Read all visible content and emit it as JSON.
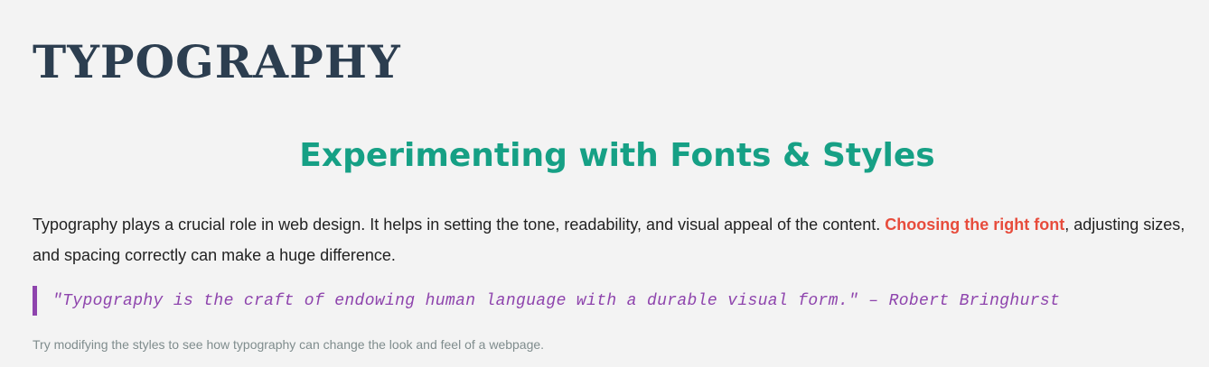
{
  "page": {
    "title": "TYPOGRAPHY",
    "subtitle": "Experimenting with Fonts & Styles",
    "paragraph": {
      "before": "Typography plays a crucial role in web design. It helps in setting the tone, readability, and visual appeal of the content. ",
      "highlight": "Choosing the right font",
      "after": ", adjusting sizes, and spacing correctly can make a huge difference."
    },
    "quote": "\"Typography is the craft of endowing human language with a durable visual form.\" – Robert Bringhurst",
    "note": "Try modifying the styles to see how typography can change the look and feel of a webpage."
  },
  "colors": {
    "background": "#f3f3f3",
    "title": "#2c3e50",
    "subtitle": "#16a085",
    "highlight": "#e74c3c",
    "quote": "#8e44ad",
    "note": "#7f8c8d"
  }
}
